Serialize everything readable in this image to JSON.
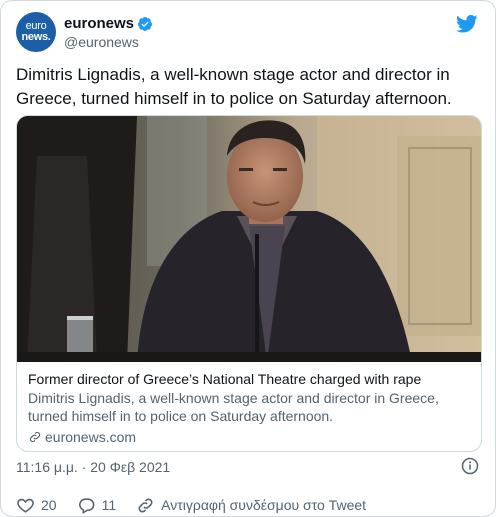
{
  "account": {
    "display_name": "euronews",
    "handle": "@euronews",
    "avatar_line1": "euro",
    "avatar_line2": "news.",
    "verified_icon": "verified-badge-icon",
    "brand_color": "#1d5ea8"
  },
  "tweet": {
    "text": "Dimitris Lignadis, a well-known stage actor and director in Greece, turned himself in to police on Saturday afternoon.",
    "timestamp": "11:16 μ.μ. · 20 Φεβ 2021"
  },
  "card": {
    "title": "Former director of Greece’s National Theatre charged with rape",
    "description": "Dimitris Lignadis, a well-known stage actor and director in Greece, turned himself in to police on Saturday afternoon.",
    "domain": "euronews.com"
  },
  "actions": {
    "likes": "20",
    "replies": "11",
    "copy_link_label": "Αντιγραφή συνδέσμου στο Tweet"
  },
  "colors": {
    "twitter_blue": "#1d9bf0",
    "secondary_text": "#536471",
    "border": "#cfd9de"
  }
}
